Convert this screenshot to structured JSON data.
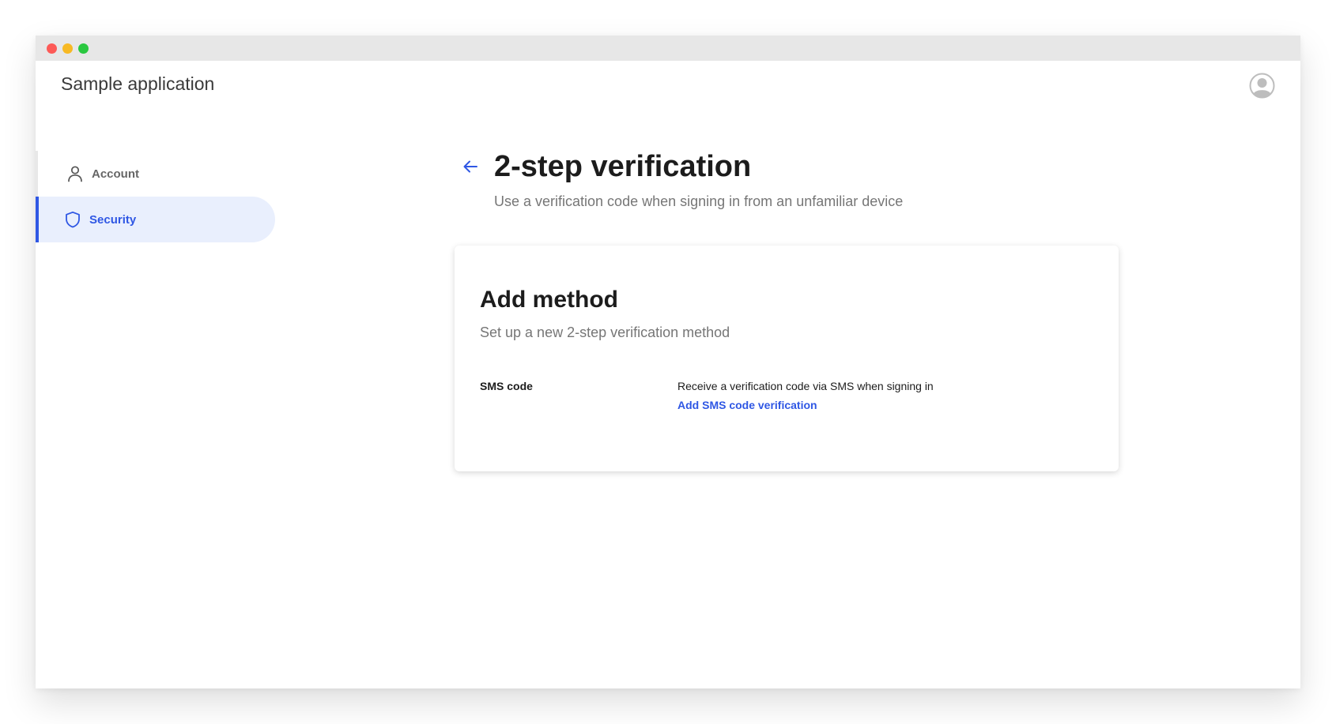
{
  "app": {
    "title": "Sample application"
  },
  "header": {
    "avatar_icon": "user-avatar-icon"
  },
  "sidebar": {
    "items": [
      {
        "label": "Account",
        "icon": "person-icon",
        "active": false
      },
      {
        "label": "Security",
        "icon": "shield-icon",
        "active": true
      }
    ]
  },
  "page": {
    "title": "2-step verification",
    "subtitle": "Use a verification code when signing in from an unfamiliar device"
  },
  "card": {
    "title": "Add method",
    "subtitle": "Set up a new 2-step verification method",
    "methods": [
      {
        "name": "SMS code",
        "description": "Receive a verification code via SMS when signing in",
        "action_label": "Add SMS code verification"
      }
    ]
  },
  "colors": {
    "accent": "#2f57e4",
    "active_bg": "#e9effd"
  }
}
